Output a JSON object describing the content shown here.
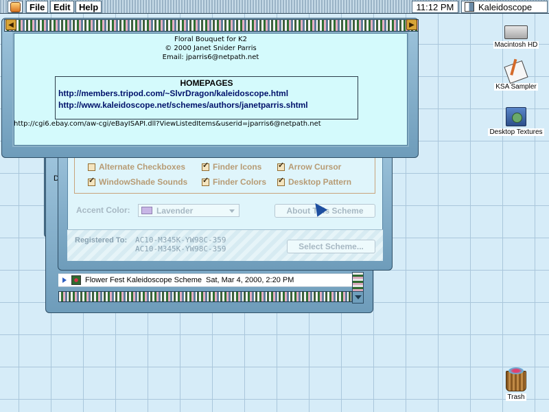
{
  "menubar": {
    "menus": [
      "File",
      "Edit",
      "Help"
    ],
    "clock": "11:12 PM",
    "active_app": "Kaleidoscope"
  },
  "about_window": {
    "scheme_name": "Floral Bouquet for K2",
    "copyright": "© 2000 Janet Snider Parris",
    "email": "Email: jparris6@netpath.net",
    "homepages_title": "HOMEPAGES",
    "homepage_1": "http://members.tripod.com/~SlvrDragon/kaleidoscope.html",
    "homepage_2": "http://www.kaleidoscope.net/schemes/authors/janetparris.shtml",
    "ebay_url": "http://cgi6.ebay.com/aw-cgi/eBayISAPI.dll?ViewListedItems&userid=jparris6@netpath.net"
  },
  "kaleidoscope_panel": {
    "options": [
      {
        "label": "Alternate Checkboxes",
        "checked": false
      },
      {
        "label": "Finder Icons",
        "checked": true
      },
      {
        "label": "Arrow Cursor",
        "checked": true
      },
      {
        "label": "WindowShade Sounds",
        "checked": true
      },
      {
        "label": "Finder Colors",
        "checked": true
      },
      {
        "label": "Desktop Pattern",
        "checked": true
      }
    ],
    "accent_label": "Accent Color:",
    "accent_value": "Lavender",
    "about_button": "About This Scheme",
    "registered_label": "Registered To:",
    "registration_codes": [
      "AC10-M345K-YW98C-359",
      "AC10-M345K-YW98C-359"
    ],
    "select_button": "Select Scheme..."
  },
  "list_window": {
    "partial_letter": "D",
    "rows": [
      {
        "name": "Flower Fest Kaleidoscope Scheme",
        "date": "Sat, Mar 4, 2000, 2:20 PM"
      }
    ]
  },
  "desktop_icons": [
    {
      "label": "Macintosh HD",
      "icon": "hard-disk-icon"
    },
    {
      "label": "KSA Sampler",
      "icon": "document-pencil-icon"
    },
    {
      "label": "Desktop Textures",
      "icon": "folder-globe-icon"
    },
    {
      "label": "Trash",
      "icon": "trash-icon"
    }
  ],
  "colors": {
    "desktop": "#d6ecf8",
    "grid": "#a9c6db",
    "panel": "#dff5fb",
    "link": "#00126b",
    "dimmed_text": "#a7b8c3"
  }
}
